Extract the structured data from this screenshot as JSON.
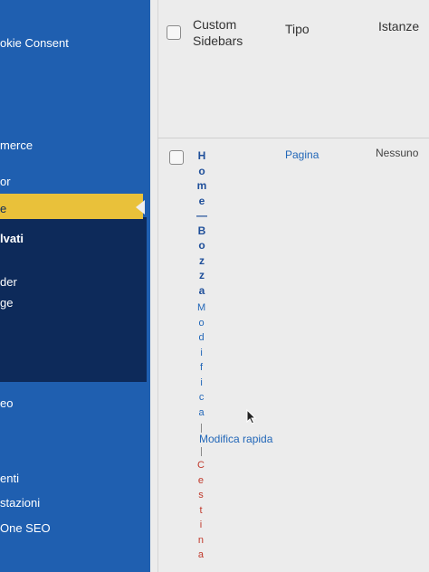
{
  "sidebar": {
    "items": [
      {
        "label": "okie Consent"
      },
      {
        "label": "merce"
      },
      {
        "label": "or"
      },
      {
        "label": "e"
      },
      {
        "label": "lvati"
      },
      {
        "label": "der"
      },
      {
        "label": "ge"
      },
      {
        "label": "eo"
      },
      {
        "label": "enti"
      },
      {
        "label": "stazioni"
      },
      {
        "label": "One SEO"
      }
    ]
  },
  "table": {
    "headers": {
      "title": "Custom Sidebars",
      "type": "Tipo",
      "instances": "Istanze"
    },
    "row": {
      "title": "Home — Bozza",
      "title_chars": [
        "H",
        "o",
        "m",
        "e",
        "—",
        "B",
        "o",
        "z",
        "z",
        "a"
      ],
      "edit_chars": [
        "M",
        "o",
        "d",
        "i",
        "f",
        "i",
        "c",
        "a"
      ],
      "quick_edit": "Modifica rapida",
      "trash_chars": [
        "C",
        "e",
        "s",
        "t",
        "i",
        "n",
        "a"
      ],
      "type": "Pagina",
      "instances": "Nessuno"
    }
  },
  "colors": {
    "sidebar_bg": "#1f5fb0",
    "submenu_bg": "#0d2a5a",
    "active_bg": "#e9c13a",
    "link": "#2267b8",
    "trash": "#c0392b"
  }
}
